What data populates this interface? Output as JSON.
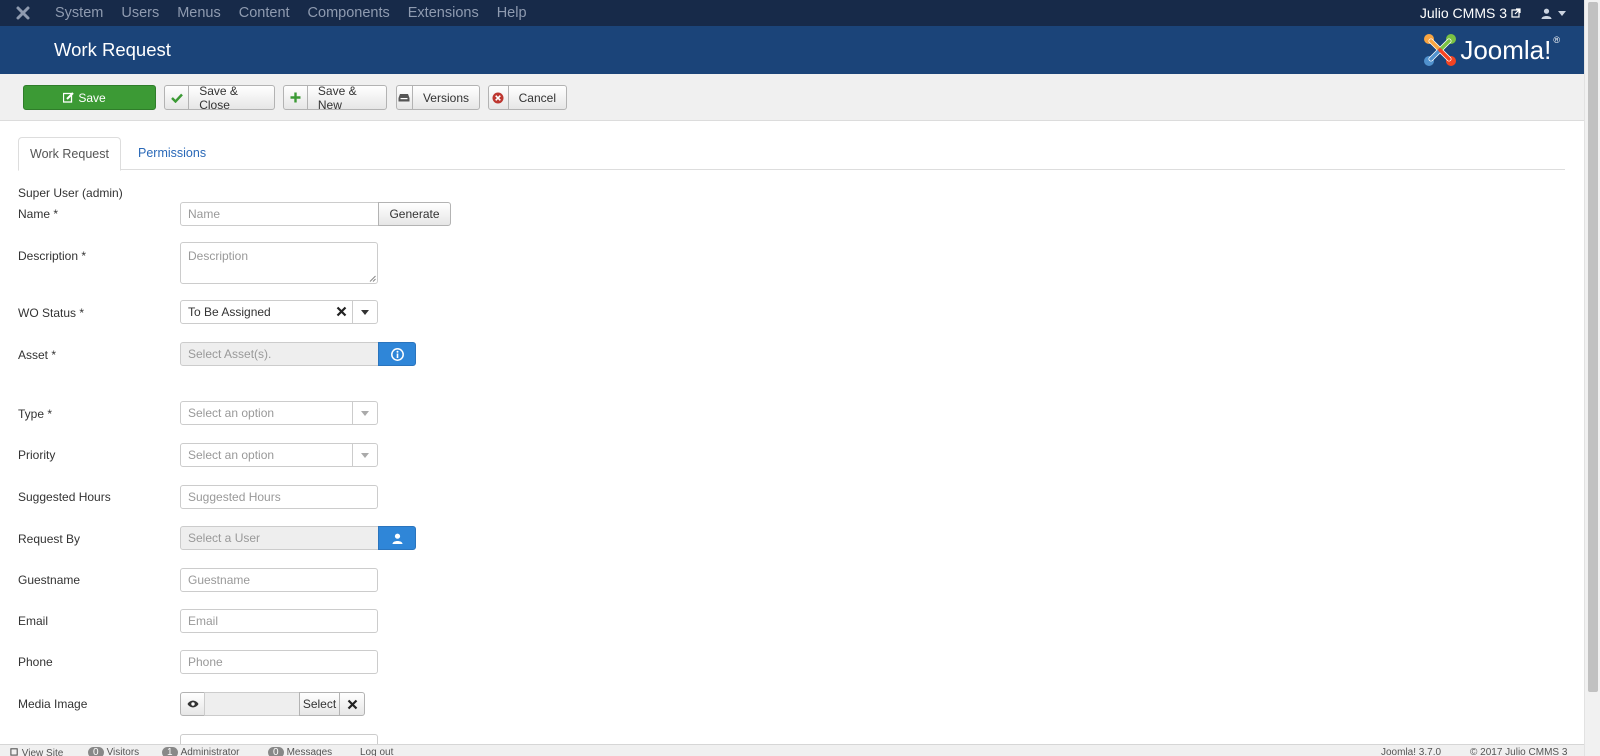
{
  "navbar": {
    "menu": [
      "System",
      "Users",
      "Menus",
      "Content",
      "Components",
      "Extensions",
      "Help"
    ],
    "site_name": "Julio CMMS 3",
    "icons": {
      "logo": "joomla-x-icon",
      "external": "external-link-icon",
      "user": "user-icon",
      "caret": "caret-down-icon"
    }
  },
  "header": {
    "title": "Work Request",
    "brand": "Joomla!",
    "brand_mark": "®"
  },
  "toolbar": {
    "save": "Save",
    "save_close": "Save & Close",
    "save_new": "Save & New",
    "versions": "Versions",
    "cancel": "Cancel"
  },
  "tabs": [
    "Work Request",
    "Permissions"
  ],
  "form": {
    "user_info": "Super User (admin)",
    "name": {
      "label": "Name *",
      "placeholder": "Name",
      "button": "Generate"
    },
    "description": {
      "label": "Description *",
      "placeholder": "Description"
    },
    "wo_status": {
      "label": "WO Status *",
      "value": "To Be Assigned"
    },
    "asset": {
      "label": "Asset *",
      "placeholder": "Select Asset(s)."
    },
    "type": {
      "label": "Type *",
      "placeholder": "Select an option"
    },
    "priority": {
      "label": "Priority",
      "placeholder": "Select an option"
    },
    "suggested_hours": {
      "label": "Suggested Hours",
      "placeholder": "Suggested Hours"
    },
    "request_by": {
      "label": "Request By",
      "placeholder": "Select a User"
    },
    "guestname": {
      "label": "Guestname",
      "placeholder": "Guestname"
    },
    "email": {
      "label": "Email",
      "placeholder": "Email"
    },
    "phone": {
      "label": "Phone",
      "placeholder": "Phone"
    },
    "media_image": {
      "label": "Media Image",
      "button": "Select"
    }
  },
  "status_bar": {
    "view_site": "View Site",
    "visitors": "Visitors",
    "visitors_count": "0",
    "administrator": "Administrator",
    "administrator_count": "1",
    "messages": "Messages",
    "messages_count": "0",
    "logout": "Log out",
    "version": "Joomla! 3.7.0",
    "copyright": "© 2017 Julio CMMS 3"
  },
  "colors": {
    "navbar_bg": "#172a49",
    "header_bg": "#1b4479",
    "save_green": "#3c9a35",
    "accent_blue": "#2f86d8",
    "link_blue": "#2a69b8"
  }
}
